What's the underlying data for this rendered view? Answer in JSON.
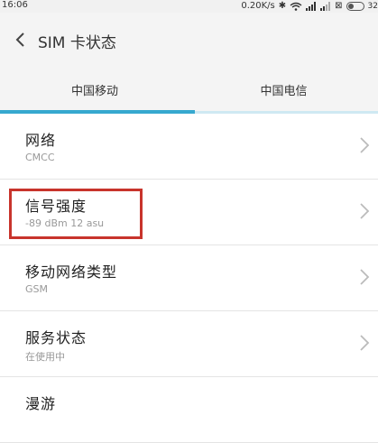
{
  "statusbar": {
    "time": "16:06",
    "speed": "0.20K/s",
    "extra": "32"
  },
  "header": {
    "title": "SIM 卡状态"
  },
  "tabs": [
    {
      "label": "中国移动",
      "active": true
    },
    {
      "label": "中国电信",
      "active": false
    }
  ],
  "items": [
    {
      "title": "网络",
      "subtitle": "CMCC"
    },
    {
      "title": "信号强度",
      "subtitle": "-89 dBm 12 asu"
    },
    {
      "title": "移动网络类型",
      "subtitle": "GSM"
    },
    {
      "title": "服务状态",
      "subtitle": "在使用中"
    },
    {
      "title": "漫游",
      "subtitle": ""
    }
  ],
  "colors": {
    "accent": "#36a8cf",
    "highlight_box": "#c8342c"
  },
  "icons": [
    "bluetooth-icon",
    "wifi-icon",
    "signal-icon",
    "back-arrow-icon",
    "chevron-right-icon"
  ]
}
